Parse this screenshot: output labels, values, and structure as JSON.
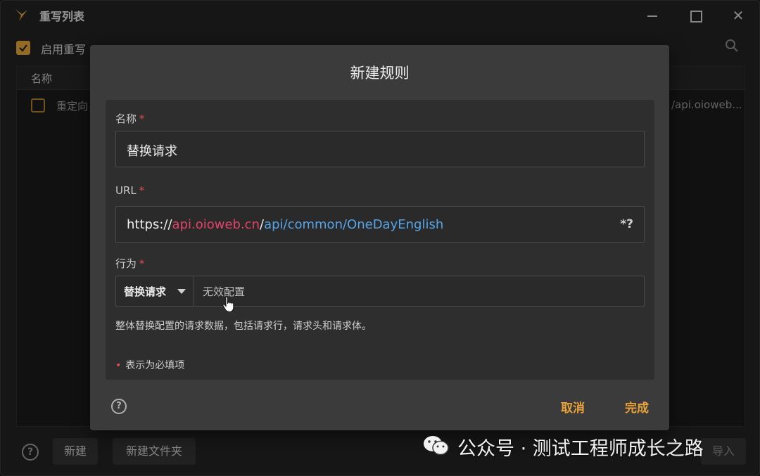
{
  "window": {
    "title": "重写列表",
    "enable_label": "启用重写",
    "table": {
      "header_name": "名称",
      "rows": [
        {
          "name": "重定向",
          "url": "/api.oioweb..."
        }
      ]
    },
    "footer": {
      "new_label": "新建",
      "new_folder_label": "新建文件夹",
      "right_label": "导入"
    }
  },
  "dialog": {
    "title": "新建规则",
    "required_mark": "*",
    "name_label": "名称",
    "name_value": "替换请求",
    "url_label": "URL",
    "url": {
      "scheme": "https://",
      "host": "api.oioweb.cn",
      "sep": "/",
      "path": "api/common/OneDayEnglish",
      "wildcard": "*?"
    },
    "action_label": "行为",
    "action_selected": "替换请求",
    "action_config": "无效配置",
    "hint": "整体替换配置的请求数据，包括请求行，请求头和请求体。",
    "required_note": "表示为必填项",
    "required_dot": "•",
    "help": "?",
    "cancel_label": "取消",
    "done_label": "完成"
  },
  "watermark": {
    "text": "公众号 · 测试工程师成长之路"
  },
  "colors": {
    "accent": "#e8a33a",
    "required": "#e04a4a",
    "url_host": "#e5426b",
    "url_path": "#55a6e8"
  },
  "icons": [
    "app-logo-icon",
    "minimize-icon",
    "maximize-icon",
    "close-icon",
    "search-icon",
    "checkbox-checked-icon",
    "checkbox-unchecked-icon",
    "help-icon",
    "dropdown-caret-icon",
    "mouse-pointer-icon",
    "wechat-icon"
  ]
}
